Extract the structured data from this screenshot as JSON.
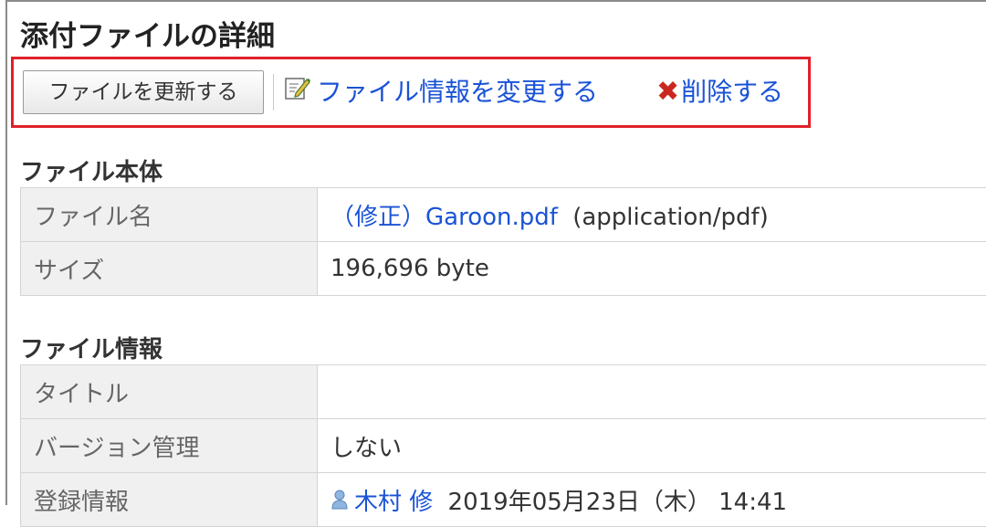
{
  "page": {
    "title": "添付ファイルの詳細"
  },
  "toolbar": {
    "update_label": "ファイルを更新する",
    "edit_label": "ファイル情報を変更する",
    "delete_label": "削除する"
  },
  "file_body": {
    "heading": "ファイル本体",
    "rows": {
      "name": {
        "label": "ファイル名",
        "link": "（修正）Garoon.pdf",
        "mime": "(application/pdf)"
      },
      "size": {
        "label": "サイズ",
        "value": "196,696 byte"
      }
    }
  },
  "file_info": {
    "heading": "ファイル情報",
    "rows": {
      "title": {
        "label": "タイトル",
        "value": ""
      },
      "version": {
        "label": "バージョン管理",
        "value": "しない"
      },
      "registered": {
        "label": "登録情報",
        "user": "木村 修",
        "date": "2019年05月23日（木） 14:41"
      }
    }
  },
  "colors": {
    "link": "#1a53d6",
    "highlight_border": "#e0202a",
    "delete_icon": "#c8281f"
  }
}
